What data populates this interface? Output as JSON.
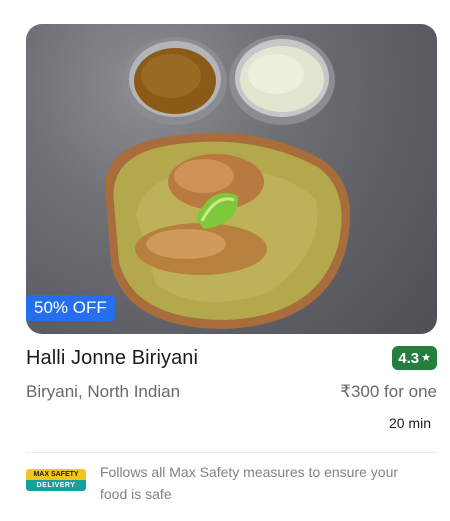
{
  "card": {
    "image_alt": "Biryani plate with two bowls",
    "offer_label": "50% OFF",
    "restaurant_name": "Halli Jonne Biriyani",
    "rating": "4.3",
    "rating_icon": "star-icon",
    "cuisine": "Biryani, North Indian",
    "price": "₹300 for one",
    "delivery_time": "20 min"
  },
  "safety": {
    "logo_top": "MAX SAFETY",
    "logo_bottom": "DELIVERY",
    "text": "Follows all Max Safety measures to ensure your food is safe"
  },
  "colors": {
    "offer_badge": "#256fef",
    "rating_badge": "#267e3e",
    "safety_yellow": "#f4c51f",
    "safety_teal": "#1aa09b"
  }
}
